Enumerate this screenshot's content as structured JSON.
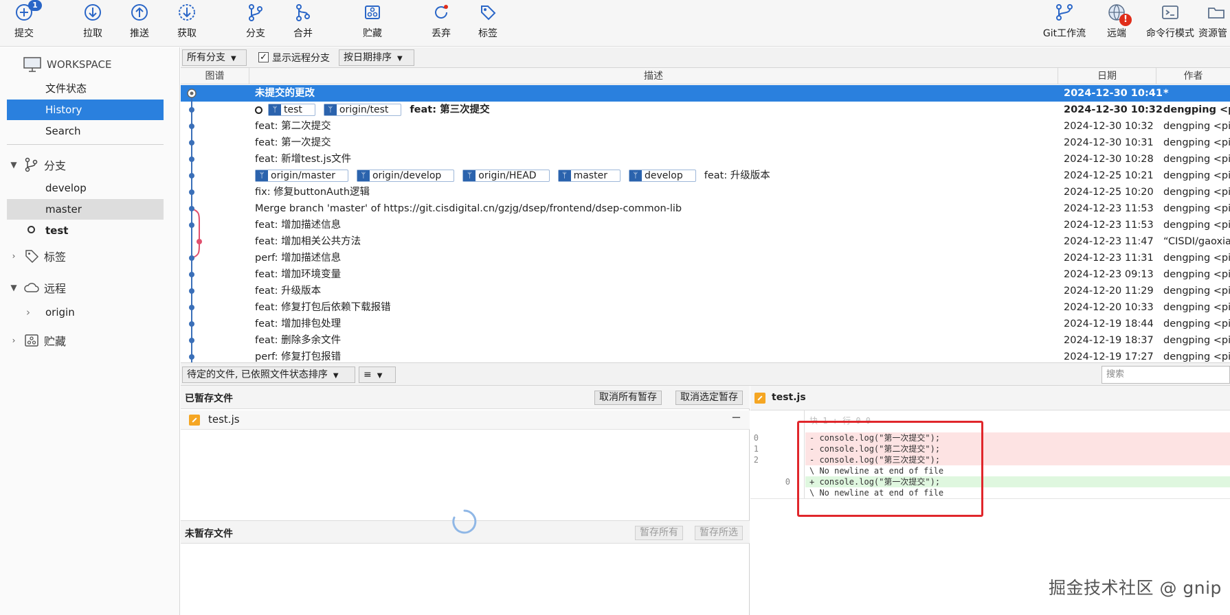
{
  "toolbar": {
    "commit": {
      "label": "提交",
      "badge": "1"
    },
    "pull": {
      "label": "拉取"
    },
    "push": {
      "label": "推送"
    },
    "fetch": {
      "label": "获取"
    },
    "branch": {
      "label": "分支"
    },
    "merge": {
      "label": "合并"
    },
    "stash": {
      "label": "贮藏"
    },
    "discard": {
      "label": "丢弃"
    },
    "tag": {
      "label": "标签"
    },
    "gitflow": {
      "label": "Git工作流"
    },
    "remote": {
      "label": "远端",
      "alert": "!"
    },
    "terminal": {
      "label": "命令行模式"
    },
    "explorer": {
      "label": "资源管"
    }
  },
  "sidebar": {
    "workspace": "WORKSPACE",
    "workspace_items": [
      "文件状态",
      "History",
      "Search"
    ],
    "branches_title": "分支",
    "branches": [
      "develop",
      "master",
      "test"
    ],
    "tags_title": "标签",
    "remotes_title": "远程",
    "remotes": [
      "origin"
    ],
    "stashes_title": "贮藏"
  },
  "filterbar": {
    "branches_select": "所有分支",
    "show_remote_label": "显示远程分支",
    "show_remote_checked": true,
    "sort_select": "按日期排序"
  },
  "columns": {
    "graph": "图谱",
    "description": "描述",
    "date": "日期",
    "author": "作者"
  },
  "commits": [
    {
      "desc": "未提交的更改",
      "date": "2024-12-30 10:41",
      "author": "*"
    },
    {
      "desc": "feat: 第三次提交",
      "date": "2024-12-30 10:32",
      "author": "dengping <p"
    },
    {
      "desc": "feat: 第二次提交",
      "date": "2024-12-30 10:32",
      "author": "dengping <pi"
    },
    {
      "desc": "feat: 第一次提交",
      "date": "2024-12-30 10:31",
      "author": "dengping <pi"
    },
    {
      "desc": "feat: 新增test.js文件",
      "date": "2024-12-30 10:28",
      "author": "dengping <pi"
    },
    {
      "desc": "feat: 升级版本",
      "date": "2024-12-25 10:21",
      "author": "dengping <pi"
    },
    {
      "desc": "fix: 修复buttonAuth逻辑",
      "date": "2024-12-25 10:20",
      "author": "dengping <pi"
    },
    {
      "desc": "Merge branch 'master' of https://git.cisdigital.cn/gzjg/dsep/frontend/dsep-common-lib",
      "date": "2024-12-23 11:53",
      "author": "dengping <pi"
    },
    {
      "desc": "feat: 增加描述信息",
      "date": "2024-12-23 11:53",
      "author": "dengping <pi"
    },
    {
      "desc": "feat: 增加相关公共方法",
      "date": "2024-12-23 11:47",
      "author": "“CISDI/gaoxia"
    },
    {
      "desc": "perf: 增加描述信息",
      "date": "2024-12-23 11:31",
      "author": "dengping <pi"
    },
    {
      "desc": "feat: 增加环境变量",
      "date": "2024-12-23 09:13",
      "author": "dengping <pi"
    },
    {
      "desc": "feat: 升级版本",
      "date": "2024-12-20 11:29",
      "author": "dengping <pi"
    },
    {
      "desc": "feat: 修复打包后依赖下载报错",
      "date": "2024-12-20 10:33",
      "author": "dengping <pi"
    },
    {
      "desc": "feat: 增加排包处理",
      "date": "2024-12-19 18:44",
      "author": "dengping <pi"
    },
    {
      "desc": "feat: 删除多余文件",
      "date": "2024-12-19 18:37",
      "author": "dengping <pi"
    },
    {
      "desc": "perf: 修复打包报错",
      "date": "2024-12-19 17:27",
      "author": "dengping <pi"
    }
  ],
  "refs_row1": [
    "test",
    "origin/test"
  ],
  "refs_row5": [
    "origin/master",
    "origin/develop",
    "origin/HEAD",
    "master",
    "develop"
  ],
  "bottombar": {
    "pending_select": "待定的文件, 已依照文件状态排序",
    "view_toggle": "≡",
    "search_placeholder": "搜索"
  },
  "staged": {
    "title": "已暂存文件",
    "unstage_all": "取消所有暂存",
    "unstage_selected": "取消选定暂存",
    "files": [
      "test.js"
    ]
  },
  "unstaged": {
    "title": "未暂存文件",
    "stage_all": "暂存所有",
    "stage_selected": "暂存所选"
  },
  "diff": {
    "file": "test.js",
    "hunk": "块 1 : 行 0-0",
    "lines": [
      {
        "old": "0",
        "new": "",
        "type": "del",
        "text": "- console.log(\"第一次提交\");"
      },
      {
        "old": "1",
        "new": "",
        "type": "del",
        "text": "- console.log(\"第二次提交\");"
      },
      {
        "old": "2",
        "new": "",
        "type": "del",
        "text": "- console.log(\"第三次提交\");"
      },
      {
        "old": "",
        "new": "",
        "type": "ctx",
        "text": "\\ No newline at end of file"
      },
      {
        "old": "",
        "new": "0",
        "type": "add",
        "text": "+ console.log(\"第一次提交\");"
      },
      {
        "old": "",
        "new": "",
        "type": "ctx",
        "text": "\\ No newline at end of file"
      }
    ]
  },
  "watermark": "掘金技术社区 @ gnip",
  "colors": {
    "accent": "#2a80de",
    "ref_icon": "#2b63ad",
    "graph_line": "#3a6fb8",
    "graph_merge": "#e0506e",
    "highlight_box": "#e0262b"
  }
}
